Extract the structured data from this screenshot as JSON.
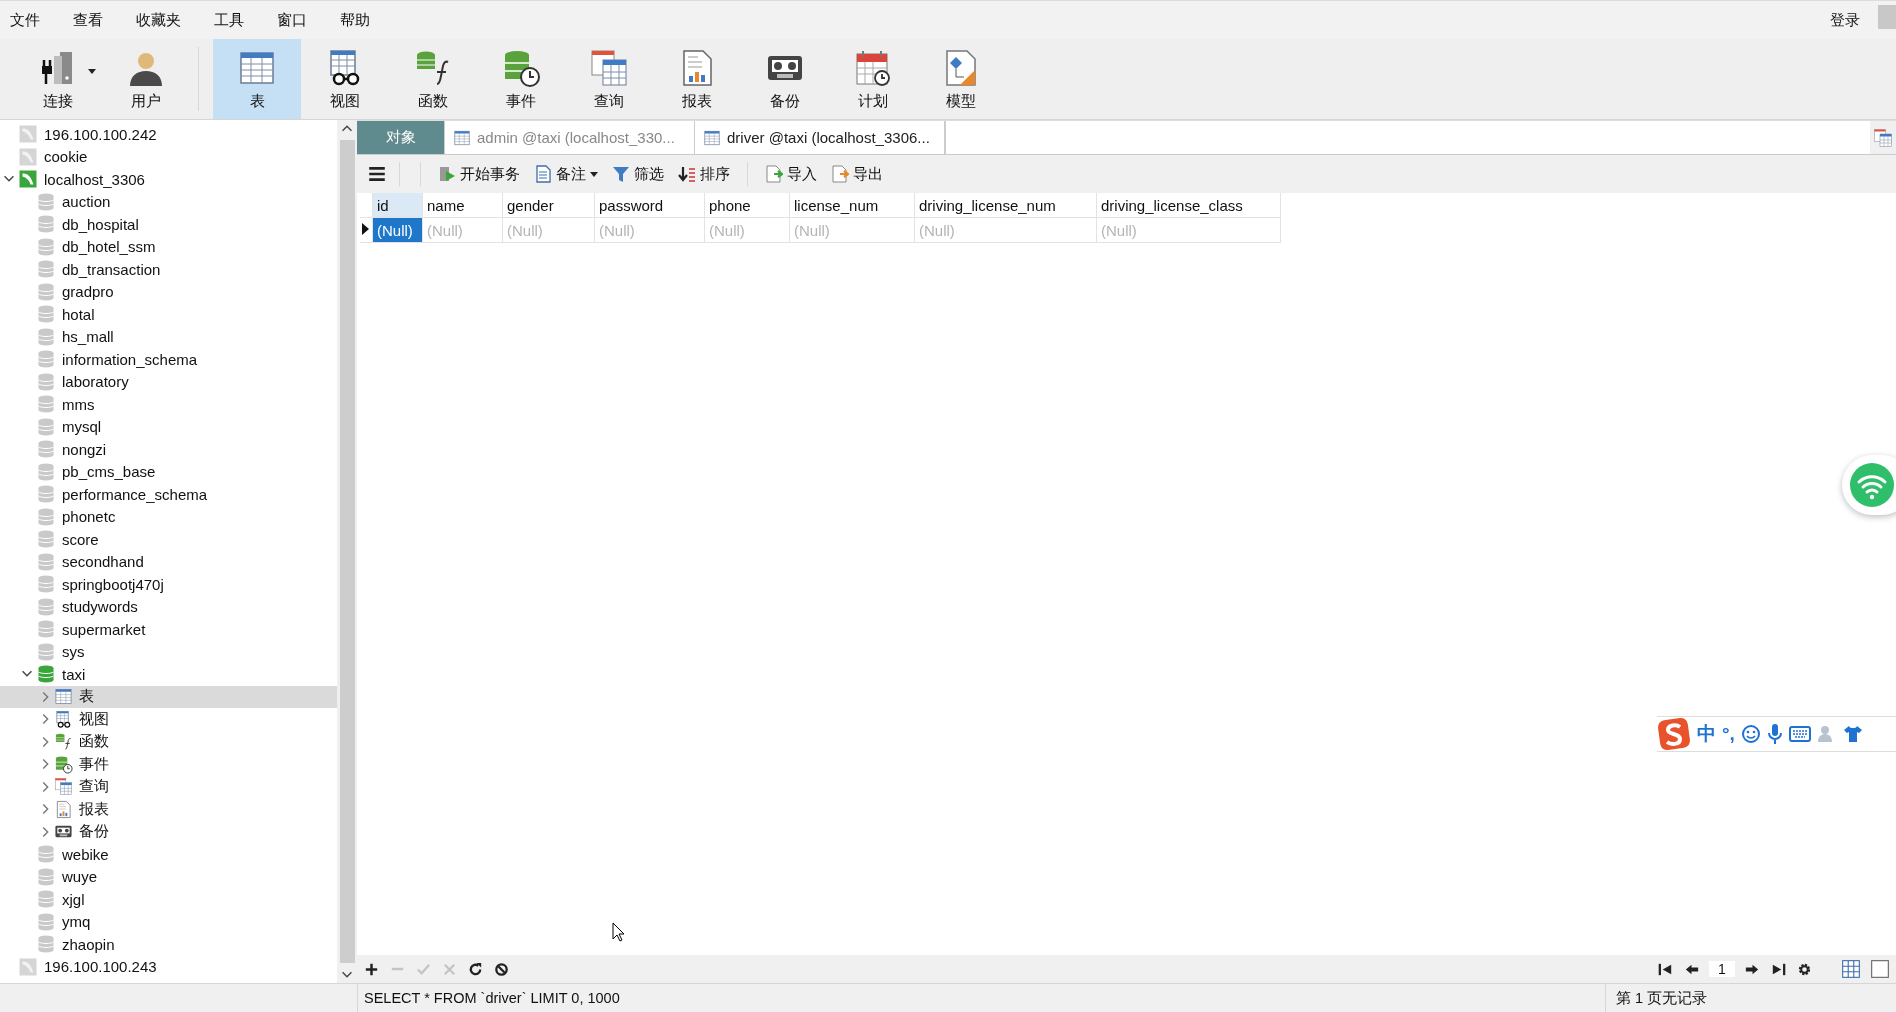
{
  "menu": {
    "items": [
      "文件",
      "查看",
      "收藏夹",
      "工具",
      "窗口",
      "帮助"
    ],
    "login": "登录"
  },
  "toolbar": {
    "buttons": [
      {
        "label": "连接",
        "kind": "connection",
        "dropdown": true,
        "selected": false
      },
      {
        "label": "用户",
        "kind": "user",
        "dropdown": false,
        "selected": false
      },
      {
        "label": "表",
        "kind": "table",
        "dropdown": false,
        "selected": true
      },
      {
        "label": "视图",
        "kind": "view",
        "dropdown": false,
        "selected": false
      },
      {
        "label": "函数",
        "kind": "function",
        "dropdown": false,
        "selected": false
      },
      {
        "label": "事件",
        "kind": "event",
        "dropdown": false,
        "selected": false
      },
      {
        "label": "查询",
        "kind": "query",
        "dropdown": false,
        "selected": false
      },
      {
        "label": "报表",
        "kind": "report",
        "dropdown": false,
        "selected": false
      },
      {
        "label": "备份",
        "kind": "backup",
        "dropdown": false,
        "selected": false
      },
      {
        "label": "计划",
        "kind": "schedule",
        "dropdown": false,
        "selected": false
      },
      {
        "label": "模型",
        "kind": "model",
        "dropdown": false,
        "selected": false
      }
    ]
  },
  "tree": {
    "items": [
      {
        "label": "196.100.100.242",
        "kind": "server",
        "active": false,
        "selected": false
      },
      {
        "label": "cookie",
        "kind": "server",
        "active": false,
        "selected": false
      },
      {
        "label": "localhost_3306",
        "kind": "server",
        "active": true,
        "selected": false,
        "expanded": true,
        "children": [
          {
            "label": "auction",
            "kind": "database",
            "active": false,
            "selected": false
          },
          {
            "label": "db_hospital",
            "kind": "database",
            "active": false,
            "selected": false
          },
          {
            "label": "db_hotel_ssm",
            "kind": "database",
            "active": false,
            "selected": false
          },
          {
            "label": "db_transaction",
            "kind": "database",
            "active": false,
            "selected": false
          },
          {
            "label": "gradpro",
            "kind": "database",
            "active": false,
            "selected": false
          },
          {
            "label": "hotal",
            "kind": "database",
            "active": false,
            "selected": false
          },
          {
            "label": "hs_mall",
            "kind": "database",
            "active": false,
            "selected": false
          },
          {
            "label": "information_schema",
            "kind": "database",
            "active": false,
            "selected": false
          },
          {
            "label": "laboratory",
            "kind": "database",
            "active": false,
            "selected": false
          },
          {
            "label": "mms",
            "kind": "database",
            "active": false,
            "selected": false
          },
          {
            "label": "mysql",
            "kind": "database",
            "active": false,
            "selected": false
          },
          {
            "label": "nongzi",
            "kind": "database",
            "active": false,
            "selected": false
          },
          {
            "label": "pb_cms_base",
            "kind": "database",
            "active": false,
            "selected": false
          },
          {
            "label": "performance_schema",
            "kind": "database",
            "active": false,
            "selected": false
          },
          {
            "label": "phonetc",
            "kind": "database",
            "active": false,
            "selected": false
          },
          {
            "label": "score",
            "kind": "database",
            "active": false,
            "selected": false
          },
          {
            "label": "secondhand",
            "kind": "database",
            "active": false,
            "selected": false
          },
          {
            "label": "springbootj470j",
            "kind": "database",
            "active": false,
            "selected": false
          },
          {
            "label": "studywords",
            "kind": "database",
            "active": false,
            "selected": false
          },
          {
            "label": "supermarket",
            "kind": "database",
            "active": false,
            "selected": false
          },
          {
            "label": "sys",
            "kind": "database",
            "active": false,
            "selected": false
          },
          {
            "label": "taxi",
            "kind": "database",
            "active": true,
            "selected": false,
            "expanded": true,
            "children": [
              {
                "label": "表",
                "kind": "table",
                "selected": true,
                "expanded": false
              },
              {
                "label": "视图",
                "kind": "view",
                "selected": false,
                "expanded": false
              },
              {
                "label": "函数",
                "kind": "function",
                "selected": false,
                "expanded": false
              },
              {
                "label": "事件",
                "kind": "event",
                "selected": false,
                "expanded": false
              },
              {
                "label": "查询",
                "kind": "query",
                "selected": false,
                "expanded": false
              },
              {
                "label": "报表",
                "kind": "report",
                "selected": false,
                "expanded": false
              },
              {
                "label": "备份",
                "kind": "backup",
                "selected": false,
                "expanded": false
              }
            ]
          },
          {
            "label": "webike",
            "kind": "database",
            "active": false,
            "selected": false
          },
          {
            "label": "wuye",
            "kind": "database",
            "active": false,
            "selected": false
          },
          {
            "label": "xjgl",
            "kind": "database",
            "active": false,
            "selected": false
          },
          {
            "label": "ymq",
            "kind": "database",
            "active": false,
            "selected": false
          },
          {
            "label": "zhaopin",
            "kind": "database",
            "active": false,
            "selected": false
          }
        ]
      },
      {
        "label": "196.100.100.243",
        "kind": "server",
        "active": false,
        "selected": false
      }
    ]
  },
  "tabs": [
    {
      "label": "对象",
      "kind": "objects",
      "selected": false
    },
    {
      "label": "admin @taxi (localhost_330...",
      "kind": "table",
      "selected": false
    },
    {
      "label": "driver @taxi (localhost_3306...",
      "kind": "table",
      "selected": true
    }
  ],
  "grid_toolbar": {
    "buttons": [
      {
        "label": "开始事务",
        "kind": "transaction",
        "dropdown": false
      },
      {
        "label": "备注",
        "kind": "memo",
        "dropdown": true
      },
      {
        "label": "筛选",
        "kind": "filter",
        "dropdown": false
      },
      {
        "label": "排序",
        "kind": "sort",
        "dropdown": false
      },
      {
        "label": "导入",
        "kind": "import",
        "dropdown": false
      },
      {
        "label": "导出",
        "kind": "export",
        "dropdown": false
      }
    ]
  },
  "table": {
    "columns": [
      {
        "label": "id",
        "selected": true
      },
      {
        "label": "name",
        "selected": false
      },
      {
        "label": "gender",
        "selected": false
      },
      {
        "label": "password",
        "selected": false
      },
      {
        "label": "phone",
        "selected": false
      },
      {
        "label": "license_num",
        "selected": false
      },
      {
        "label": "driving_license_num",
        "selected": false
      },
      {
        "label": "driving_license_class",
        "selected": false
      }
    ],
    "rows": [
      {
        "current": true,
        "cells": [
          {
            "text": "(Null)",
            "selected": true
          },
          {
            "text": "(Null)",
            "selected": false
          },
          {
            "text": "(Null)",
            "selected": false
          },
          {
            "text": "(Null)",
            "selected": false
          },
          {
            "text": "(Null)",
            "selected": false
          },
          {
            "text": "(Null)",
            "selected": false
          },
          {
            "text": "(Null)",
            "selected": false
          },
          {
            "text": "(Null)",
            "selected": false
          }
        ]
      }
    ]
  },
  "record_bar": {
    "buttons": [
      {
        "kind": "add",
        "disabled": false
      },
      {
        "kind": "delete",
        "disabled": true
      },
      {
        "kind": "apply",
        "disabled": true
      },
      {
        "kind": "discard",
        "disabled": true
      },
      {
        "kind": "refresh",
        "disabled": false
      },
      {
        "kind": "stop",
        "disabled": false
      }
    ],
    "page": "1"
  },
  "status_bar": {
    "sql": "SELECT * FROM `driver` LIMIT 0, 1000",
    "page_info": "第 1 页无记录"
  },
  "ime": {
    "mode": "中",
    "punctuation": "°,"
  }
}
